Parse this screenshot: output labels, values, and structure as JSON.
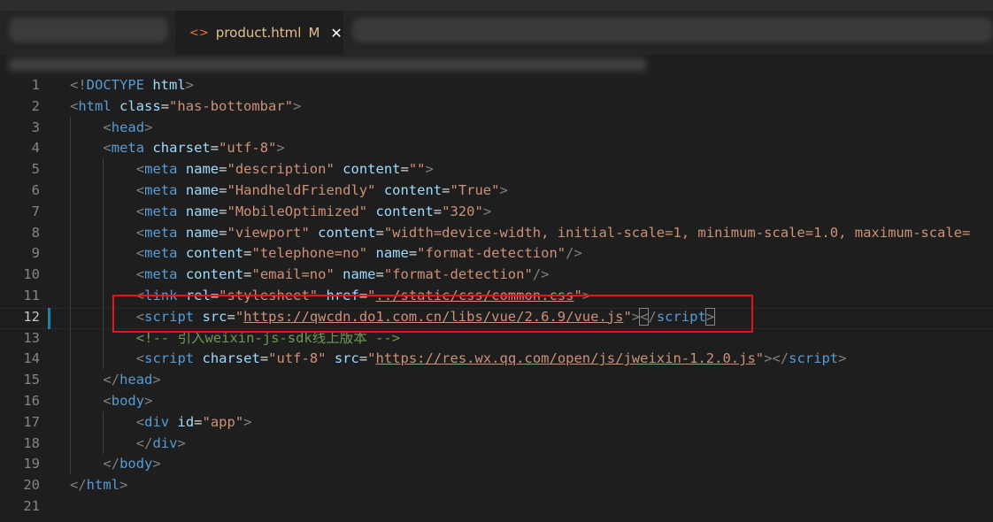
{
  "tabs": {
    "active_filename": "product.html",
    "active_modified": "M",
    "active_icon": "html-file-icon",
    "close_icon": "close-icon"
  },
  "editor": {
    "active_line": 12,
    "lines": [
      {
        "n": "1"
      },
      {
        "n": "2"
      },
      {
        "n": "3"
      },
      {
        "n": "4"
      },
      {
        "n": "5"
      },
      {
        "n": "6"
      },
      {
        "n": "7"
      },
      {
        "n": "8"
      },
      {
        "n": "9"
      },
      {
        "n": "10"
      },
      {
        "n": "11"
      },
      {
        "n": "12"
      },
      {
        "n": "13"
      },
      {
        "n": "14"
      },
      {
        "n": "15"
      },
      {
        "n": "16"
      },
      {
        "n": "17"
      },
      {
        "n": "18"
      },
      {
        "n": "19"
      },
      {
        "n": "20"
      },
      {
        "n": "21"
      }
    ],
    "code": {
      "l1": [
        "<!",
        "DOCTYPE",
        " ",
        "html",
        ">"
      ],
      "l2": [
        "<",
        "html",
        " ",
        "class",
        "=",
        "\"has-bottombar\"",
        ">"
      ],
      "l3": [
        "<",
        "head",
        ">"
      ],
      "l4": [
        "<",
        "meta",
        " ",
        "charset",
        "=",
        "\"utf-8\"",
        ">"
      ],
      "l5": [
        "<",
        "meta",
        " ",
        "name",
        "=",
        "\"description\"",
        " ",
        "content",
        "=",
        "\"\"",
        ">"
      ],
      "l6": [
        "<",
        "meta",
        " ",
        "name",
        "=",
        "\"HandheldFriendly\"",
        " ",
        "content",
        "=",
        "\"True\"",
        ">"
      ],
      "l7": [
        "<",
        "meta",
        " ",
        "name",
        "=",
        "\"MobileOptimized\"",
        " ",
        "content",
        "=",
        "\"320\"",
        ">"
      ],
      "l8": [
        "<",
        "meta",
        " ",
        "name",
        "=",
        "\"viewport\"",
        " ",
        "content",
        "=",
        "\"width=device-width, initial-scale=1, minimum-scale=1.0, maximum-scale="
      ],
      "l9": [
        "<",
        "meta",
        " ",
        "content",
        "=",
        "\"telephone=no\"",
        " ",
        "name",
        "=",
        "\"format-detection\"",
        "/>"
      ],
      "l10": [
        "<",
        "meta",
        " ",
        "content",
        "=",
        "\"email=no\"",
        " ",
        "name",
        "=",
        "\"format-detection\"",
        "/>"
      ],
      "l11": [
        "<",
        "link",
        " ",
        "rel",
        "=",
        "\"stylesheet\"",
        " ",
        "href",
        "=",
        "\"",
        "../static/css/common.css",
        "\"",
        ">"
      ],
      "l12": [
        "<",
        "script",
        " ",
        "src",
        "=",
        "\"",
        "https://qwcdn.do1.com.cn/libs/vue/2.6.9/vue.js",
        "\"",
        ">",
        "<",
        "/",
        "script",
        ">"
      ],
      "l13": [
        "<!-- 引入weixin-js-sdk线上版本 -->"
      ],
      "l14": [
        "<",
        "script",
        " ",
        "charset",
        "=",
        "\"utf-8\"",
        " ",
        "src",
        "=",
        "\"",
        "https://res.wx.qq.com/open/js/jweixin-1.2.0.js",
        "\"",
        "></",
        "script",
        ">"
      ],
      "l15": [
        "</",
        "head",
        ">"
      ],
      "l16": [
        "<",
        "body",
        ">"
      ],
      "l17": [
        "<",
        "div",
        " ",
        "id",
        "=",
        "\"app\"",
        ">"
      ],
      "l18": [
        "</",
        "div",
        ">"
      ],
      "l19": [
        "</",
        "body",
        ">"
      ],
      "l20": [
        "</",
        "html",
        ">"
      ]
    }
  }
}
